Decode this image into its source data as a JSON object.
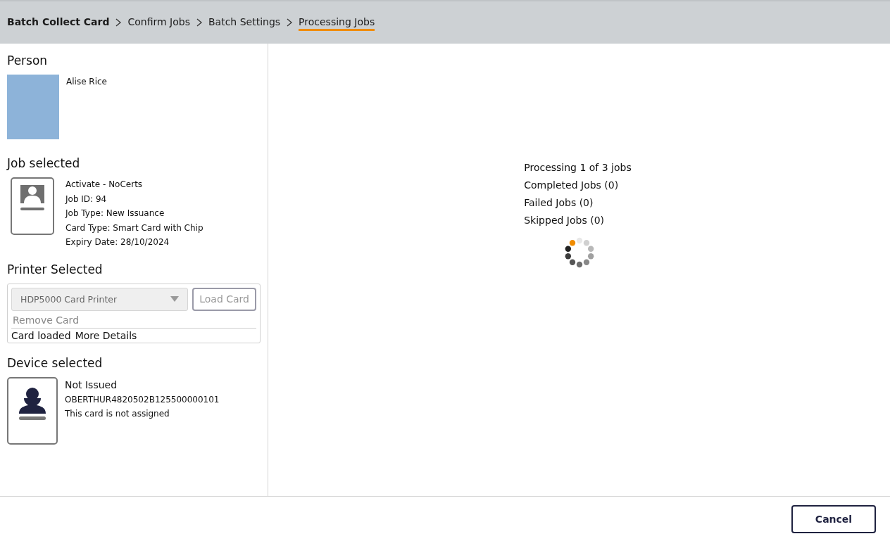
{
  "breadcrumb": [
    {
      "label": "Batch Collect Card",
      "selected": false,
      "kind": "root"
    },
    {
      "label": "Confirm Jobs",
      "selected": false,
      "kind": "step"
    },
    {
      "label": "Batch Settings",
      "selected": false,
      "kind": "step"
    },
    {
      "label": "Processing Jobs",
      "selected": true,
      "kind": "step"
    }
  ],
  "person": {
    "heading": "Person",
    "name": "Alise Rice"
  },
  "job": {
    "heading": "Job selected",
    "lines": [
      "Activate - NoCerts",
      "Job ID: 94",
      "Job Type: New Issuance",
      "Card Type: Smart Card with Chip",
      "Expiry Date: 28/10/2024"
    ]
  },
  "printer": {
    "heading": "Printer Selected",
    "select_value": "HDP5000 Card Printer",
    "disabled": true,
    "load_button": "Load Card",
    "remove_link": "Remove Card",
    "status": "Card loaded",
    "details_link": "More Details"
  },
  "device": {
    "heading": "Device selected",
    "status": "Not Issued",
    "serial": "OBERTHUR4820502B125500000101",
    "note": "This card is not assigned"
  },
  "progress": {
    "lines": [
      "Processing 1 of 3 jobs",
      "Completed Jobs (0)",
      "Failed Jobs (0)",
      "Skipped Jobs (0)"
    ]
  },
  "footer": {
    "cancel": "Cancel"
  }
}
